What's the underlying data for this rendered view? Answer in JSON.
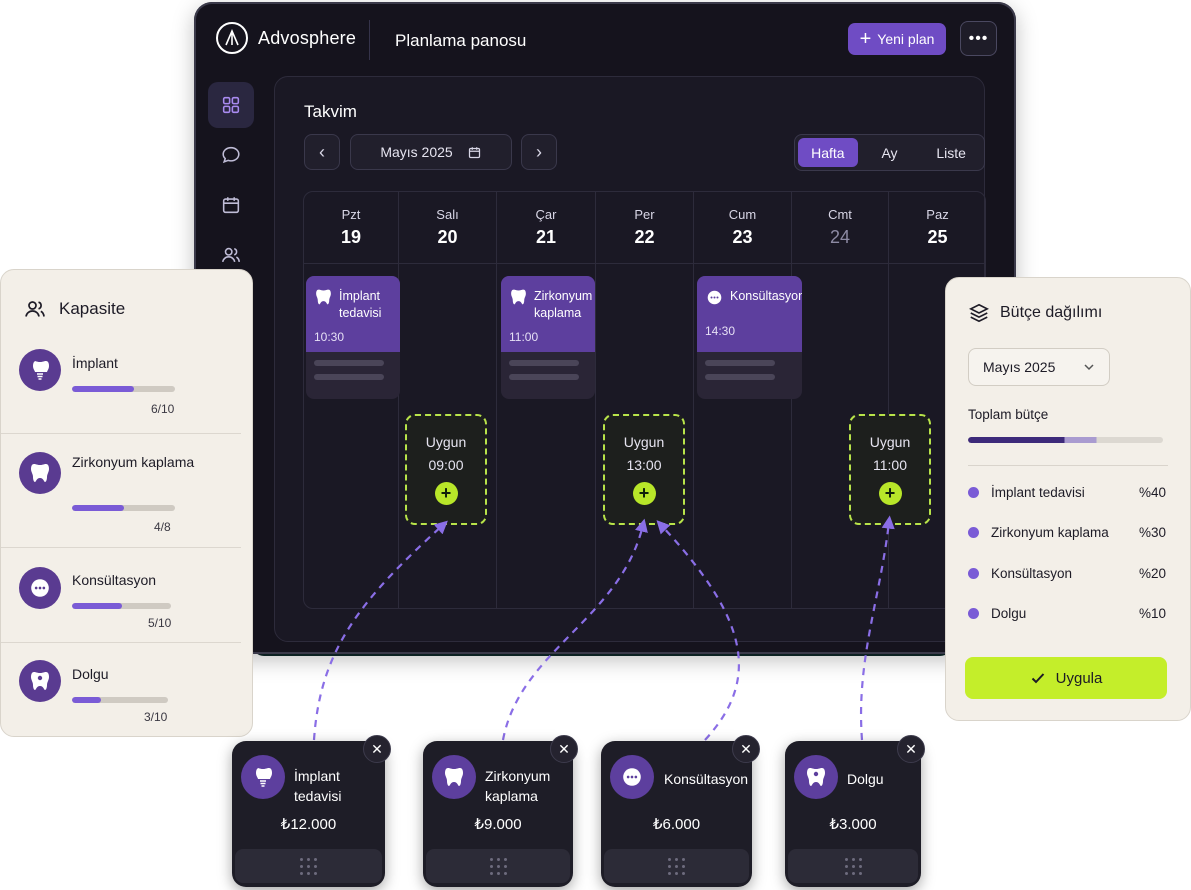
{
  "app": {
    "brand_name": "Advosphere",
    "page_title": "Planlama panosu",
    "new_plan_label": "Yeni plan",
    "more_label": "•••"
  },
  "sidebar": {
    "items": [
      {
        "icon": "grid-icon"
      },
      {
        "icon": "chat-icon"
      },
      {
        "icon": "calendar-icon"
      },
      {
        "icon": "users-icon"
      },
      {
        "icon": "chart-icon"
      },
      {
        "icon": "gear-icon"
      }
    ]
  },
  "calendar": {
    "title": "Takvim",
    "prev_label": "‹",
    "next_label": "›",
    "month": "Mayıs 2025",
    "views": [
      "Hafta",
      "Ay",
      "Liste"
    ],
    "active_view": "Hafta",
    "days": [
      {
        "name": "Pzt",
        "num": "19"
      },
      {
        "name": "Salı",
        "num": "20"
      },
      {
        "name": "Çar",
        "num": "21"
      },
      {
        "name": "Per",
        "num": "22"
      },
      {
        "name": "Cum",
        "num": "23"
      },
      {
        "name": "Cmt",
        "num": "24"
      },
      {
        "name": "Paz",
        "num": "25"
      }
    ],
    "events": [
      {
        "title": "İmplant tedavisi",
        "time": "10:30",
        "icon": "implant-tooth-icon"
      },
      {
        "title": "Zirkonyum kaplama",
        "time": "11:00",
        "icon": "tooth-icon"
      },
      {
        "title": "Konsültasyon",
        "time": "14:30",
        "icon": "chat-bubble-icon"
      }
    ],
    "slots": [
      {
        "label": "Uygun",
        "time": "09:00",
        "add": "+"
      },
      {
        "label": "Uygun",
        "time": "13:00",
        "add": "+"
      },
      {
        "label": "Uygun",
        "time": "11:00",
        "add": "+"
      }
    ]
  },
  "capacity": {
    "title": "Kapasite",
    "items": [
      {
        "name": "İmplant",
        "count": "6/10",
        "fill": 0.6
      },
      {
        "name": "Zirkonyum kaplama",
        "count": "4/8",
        "fill": 0.5
      },
      {
        "name": "Konsültasyon",
        "count": "5/10",
        "fill": 0.5
      },
      {
        "name": "Dolgu",
        "count": "3/10",
        "fill": 0.3
      }
    ]
  },
  "budget": {
    "title": "Bütçe dağılımı",
    "month": "Mayıs 2025",
    "total_label": "Toplam bütçe",
    "total_fill": 0.66,
    "rows": [
      {
        "name": "İmplant tedavisi",
        "pct": "%40"
      },
      {
        "name": "Zirkonyum kaplama",
        "pct": "%30"
      },
      {
        "name": "Konsültasyon",
        "pct": "%20"
      },
      {
        "name": "Dolgu",
        "pct": "%10"
      }
    ],
    "apply_label": "Uygula"
  },
  "services": [
    {
      "name": "İmplant tedavisi",
      "price": "₺12.000",
      "close": "✕"
    },
    {
      "name": "Zirkonyum kaplama",
      "price": "₺9.000",
      "close": "✕"
    },
    {
      "name": "Konsültasyon",
      "price": "₺6.000",
      "close": "✕"
    },
    {
      "name": "Dolgu",
      "price": "₺3.000",
      "close": "✕"
    }
  ],
  "colors": {
    "accent": "#6f4cc4",
    "lime": "#c4ee2a",
    "dark_bg": "#15131d",
    "card_bg": "#f3efe8"
  }
}
